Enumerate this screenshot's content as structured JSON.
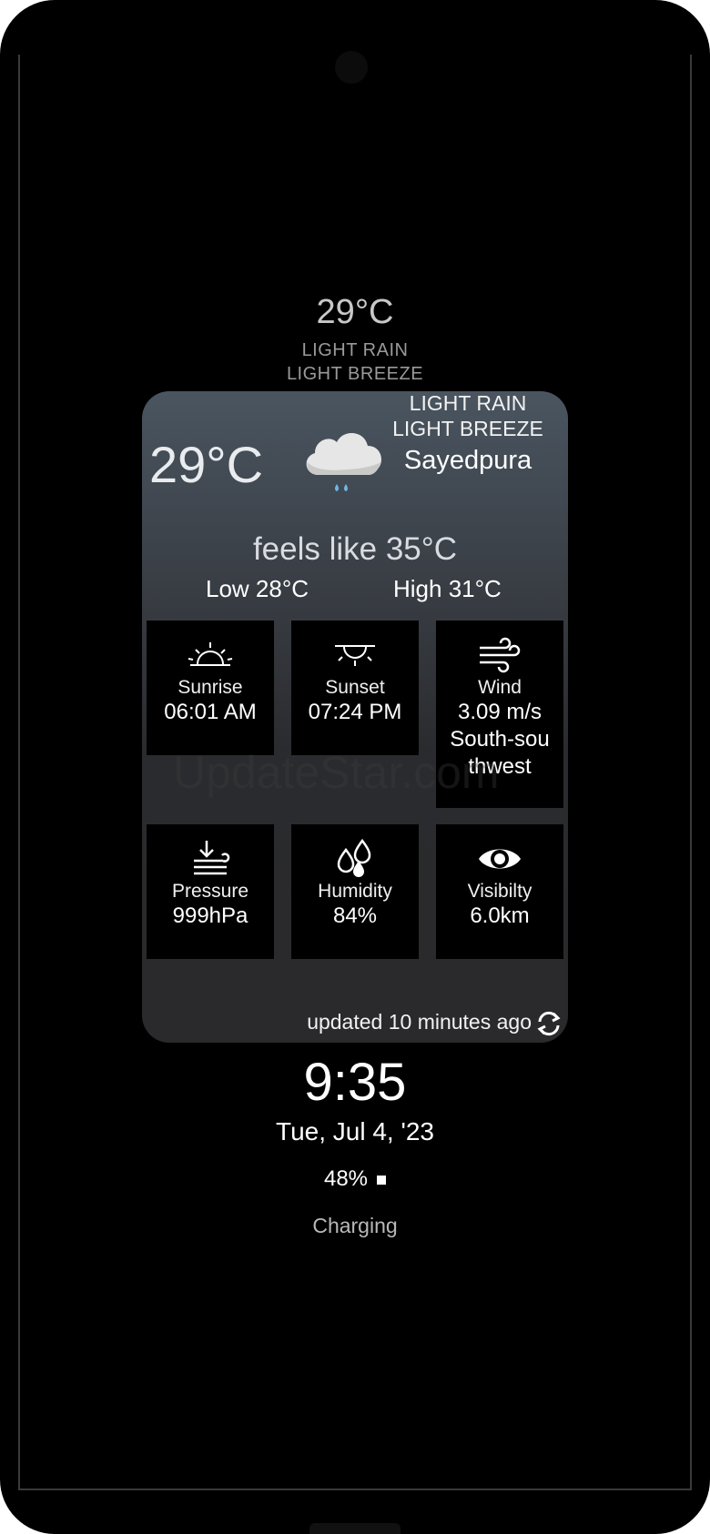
{
  "ambient": {
    "temperature": "29°C",
    "condition": "LIGHT RAIN",
    "wind": "LIGHT BREEZE"
  },
  "widget": {
    "temperature": "29°C",
    "condition": "LIGHT RAIN",
    "wind": "LIGHT BREEZE",
    "city": "Sayedpura",
    "feels_like": "feels like 35°C",
    "low": "Low 28°C",
    "high": "High 31°C",
    "tiles": [
      {
        "label": "Sunrise",
        "value": "06:01 AM",
        "icon": "sunrise-icon"
      },
      {
        "label": "Sunset",
        "value": "07:24 PM",
        "icon": "sunset-icon"
      },
      {
        "label": "Wind",
        "value": "3.09 m/s",
        "value2": "South-sou",
        "value3": "thwest",
        "icon": "wind-icon"
      },
      {
        "label": "Pressure",
        "value": "999hPa",
        "icon": "pressure-icon"
      },
      {
        "label": "Humidity",
        "value": "84%",
        "icon": "humidity-icon"
      },
      {
        "label": "Visibilty",
        "value": "6.0km",
        "icon": "eye-icon"
      }
    ],
    "updated": "updated 10 minutes ago"
  },
  "watermark": "UpdateStar.com",
  "lockscreen": {
    "time": "9:35",
    "date": "Tue, Jul 4, '23",
    "battery": "48%",
    "status": "Charging"
  },
  "colors": {
    "background": "#000000",
    "card_top": "#4a5560",
    "card_bottom": "#2a2a2c",
    "tile": "#000000",
    "rain_drop": "#6fb6e6"
  }
}
